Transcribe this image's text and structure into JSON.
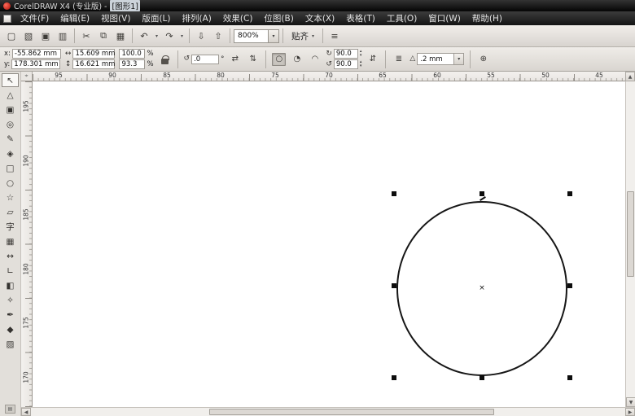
{
  "colors": {
    "titlebar_bg": "#0a0a0a",
    "menubar_bg": "#1e1e1e",
    "toolbar_bg": "#dcd8d3",
    "canvas_bg": "#ffffff",
    "shape_outline": "#161616"
  },
  "window": {
    "title_prefix": "CorelDRAW X4 (专业版) - ",
    "title_doc": "[图形1]"
  },
  "menubar": {
    "items": [
      "文件(F)",
      "编辑(E)",
      "视图(V)",
      "版面(L)",
      "排列(A)",
      "效果(C)",
      "位图(B)",
      "文本(X)",
      "表格(T)",
      "工具(O)",
      "窗口(W)",
      "帮助(H)"
    ]
  },
  "toolbar": {
    "new_glyph": "▢",
    "open_glyph": "▧",
    "save_glyph": "▣",
    "print_glyph": "▥",
    "cut_glyph": "✂",
    "copy_glyph": "⧉",
    "paste_glyph": "▦",
    "undo_glyph": "↶",
    "redo_glyph": "↷",
    "dropdown_glyph": "▾",
    "import_glyph": "⇩",
    "export_glyph": "⇧",
    "zoom_value": "800%",
    "snap_label": "贴齐",
    "options_glyph": "≡"
  },
  "property_bar": {
    "x_label": "x:",
    "x_value": "-55.862 mm",
    "y_label": "y:",
    "y_value": "178.301 mm",
    "width_glyph": "↔",
    "width_value": "15.609 mm",
    "height_glyph": "↕",
    "height_value": "16.621 mm",
    "scale_h_value": "100.0",
    "scale_v_value": "93.3",
    "percent_sign": "%",
    "rotation_glyph": "↺",
    "rotation_value": ".0",
    "degree_sign": "°",
    "mirror_h_glyph": "⇄",
    "mirror_v_glyph": "⇅",
    "ellipse_glyph": "○",
    "pie_glyph": "◔",
    "arc_glyph": "◠",
    "arc_start_glyph": "↻",
    "arc_start_value": "90.0",
    "arc_end_glyph": "↺",
    "arc_end_value": "90.0",
    "direction_glyph": "⇵",
    "wrap_glyph": "≣",
    "outline_pen_glyph": "△",
    "outline_width_value": ".2 mm",
    "quick_customize_glyph": "⊕"
  },
  "rulers": {
    "horizontal_labels": [
      "95",
      "90",
      "85",
      "80",
      "75",
      "70",
      "65",
      "60",
      "55",
      "50",
      "45"
    ],
    "vertical_labels": [
      "195",
      "190",
      "185",
      "180",
      "175",
      "170"
    ]
  },
  "toolbox": {
    "tools": [
      {
        "name": "pick-tool",
        "glyph": "↖"
      },
      {
        "name": "shape-tool",
        "glyph": "△"
      },
      {
        "name": "crop-tool",
        "glyph": "▣"
      },
      {
        "name": "zoom-tool",
        "glyph": "◎"
      },
      {
        "name": "freehand-tool",
        "glyph": "✎"
      },
      {
        "name": "smart-fill-tool",
        "glyph": "◈"
      },
      {
        "name": "rectangle-tool",
        "glyph": "□"
      },
      {
        "name": "ellipse-tool",
        "glyph": "○"
      },
      {
        "name": "polygon-tool",
        "glyph": "☆"
      },
      {
        "name": "basic-shapes-tool",
        "glyph": "▱"
      },
      {
        "name": "text-tool",
        "glyph": "字"
      },
      {
        "name": "table-tool",
        "glyph": "▦"
      },
      {
        "name": "dimension-tool",
        "glyph": "↔"
      },
      {
        "name": "connector-tool",
        "glyph": "∟"
      },
      {
        "name": "blend-tool",
        "glyph": "◧"
      },
      {
        "name": "eyedropper-tool",
        "glyph": "✧"
      },
      {
        "name": "outline-pen-tool",
        "glyph": "✒"
      },
      {
        "name": "fill-tool",
        "glyph": "◆"
      },
      {
        "name": "interactive-fill-tool",
        "glyph": "▨"
      }
    ],
    "overflow_glyph": "▤"
  },
  "canvas": {
    "center_mark": "×"
  },
  "scrollbars": {
    "up_glyph": "▲",
    "down_glyph": "▼",
    "left_glyph": "◀",
    "right_glyph": "▶"
  }
}
